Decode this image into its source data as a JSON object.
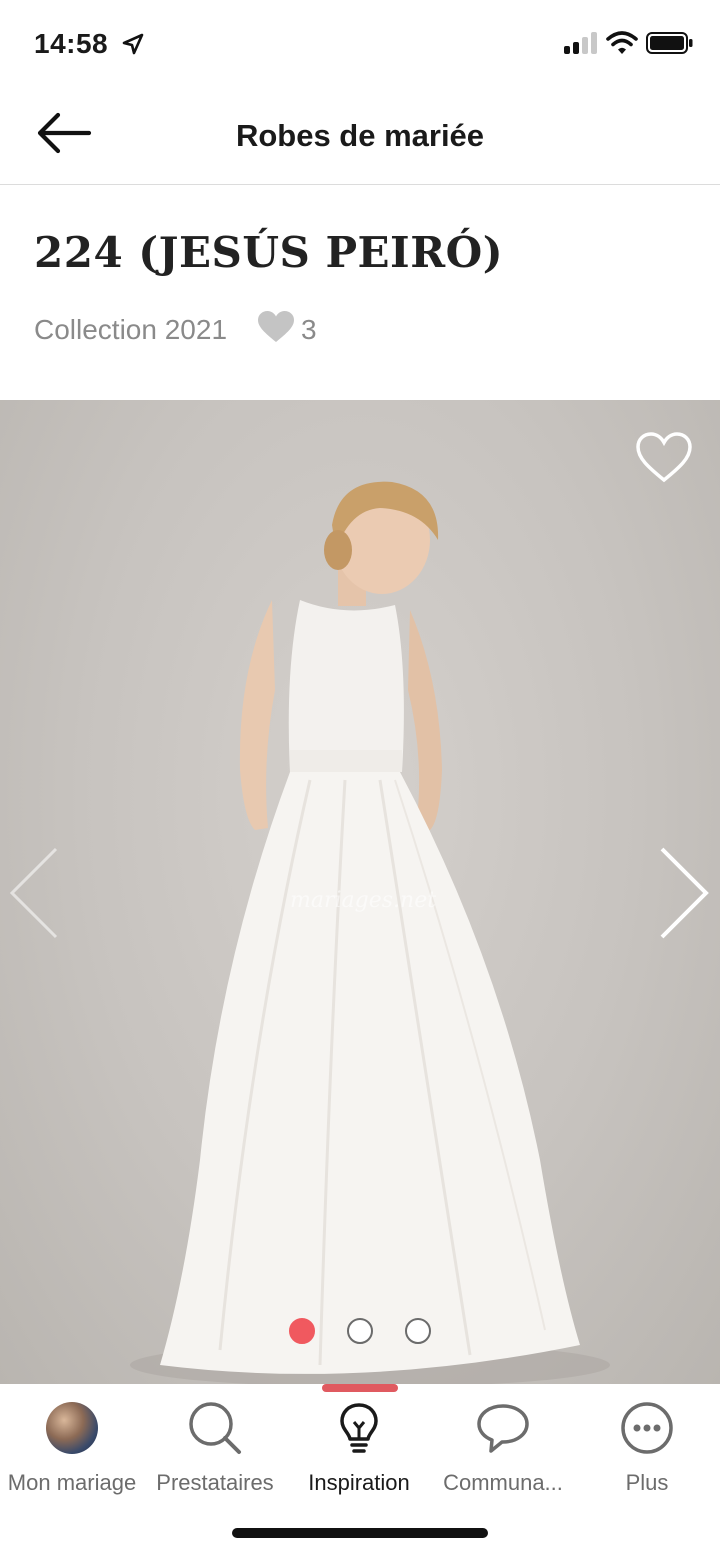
{
  "status": {
    "time": "14:58"
  },
  "nav": {
    "title": "Robes de mariée"
  },
  "product": {
    "title": "224 (JESÚS PEIRÓ)",
    "collection": "Collection 2021",
    "likes": "3",
    "watermark": "mariages.net"
  },
  "gallery": {
    "image_count": 3,
    "active_index": 0
  },
  "tabs": [
    {
      "label": "Mon mariage",
      "icon": "avatar"
    },
    {
      "label": "Prestataires",
      "icon": "search-icon"
    },
    {
      "label": "Inspiration",
      "icon": "lightbulb-icon"
    },
    {
      "label": "Communa...",
      "icon": "chat-icon"
    },
    {
      "label": "Plus",
      "icon": "more-icon"
    }
  ],
  "colors": {
    "accent": "#f0595f",
    "tab_indicator": "#e05a60"
  }
}
